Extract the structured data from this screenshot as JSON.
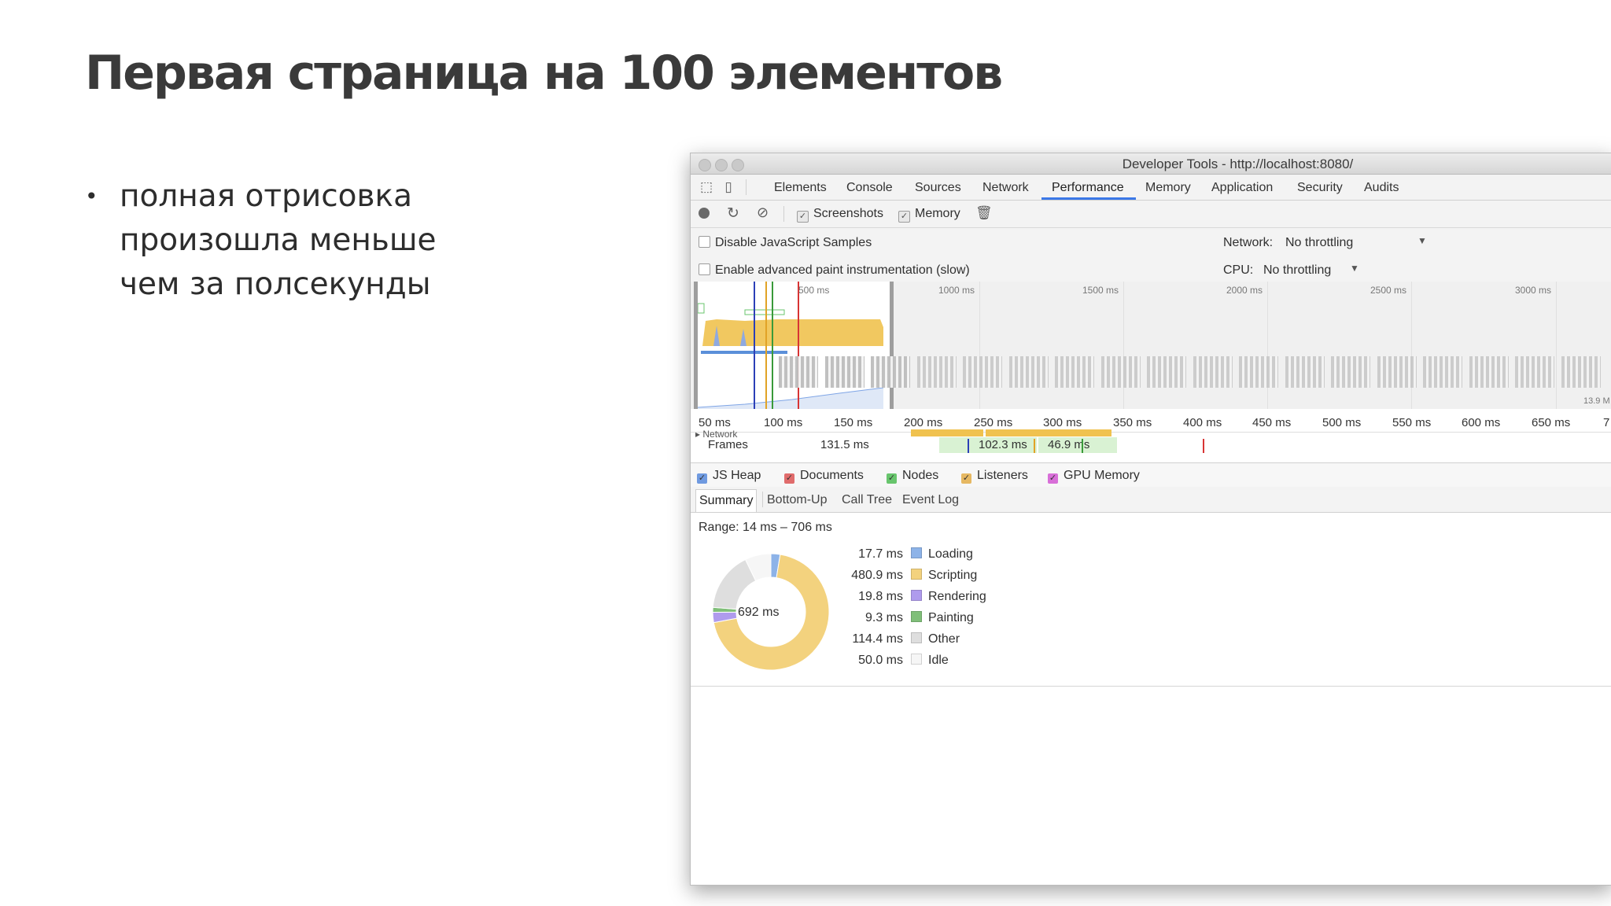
{
  "slide": {
    "title": "Первая страница на 100 элементов",
    "bullet": [
      "полная отрисовка",
      "произошла меньше",
      "чем за полсекунды"
    ]
  },
  "window": {
    "title": "Developer Tools - http://localhost:8080/"
  },
  "tabs": [
    "Elements",
    "Console",
    "Sources",
    "Network",
    "Performance",
    "Memory",
    "Application",
    "Security",
    "Audits"
  ],
  "active_tab": "Performance",
  "controls": {
    "screenshots": "Screenshots",
    "memory": "Memory"
  },
  "settings": {
    "disable_js": "Disable JavaScript Samples",
    "advanced_paint": "Enable advanced paint instrumentation (slow)",
    "network_label": "Network:",
    "network_value": "No throttling",
    "cpu_label": "CPU:",
    "cpu_value": "No throttling"
  },
  "overview": {
    "ticks": [
      "500 ms",
      "1000 ms",
      "1500 ms",
      "2000 ms",
      "2500 ms",
      "3000 ms"
    ],
    "mem_label": "13.9 M"
  },
  "ruler": [
    "50 ms",
    "100 ms",
    "150 ms",
    "200 ms",
    "250 ms",
    "300 ms",
    "350 ms",
    "400 ms",
    "450 ms",
    "500 ms",
    "550 ms",
    "600 ms",
    "650 ms",
    "7"
  ],
  "tracks": {
    "network": "Network",
    "frames": "Frames",
    "f1": "131.5 ms",
    "f2": "102.3 ms",
    "f3": "46.9 ms"
  },
  "legend": [
    {
      "label": "JS Heap",
      "color": "#6f9ae0"
    },
    {
      "label": "Documents",
      "color": "#e06c6c"
    },
    {
      "label": "Nodes",
      "color": "#68c56d"
    },
    {
      "label": "Listeners",
      "color": "#e6b862"
    },
    {
      "label": "GPU Memory",
      "color": "#d86fd8"
    }
  ],
  "subtabs": [
    "Summary",
    "Bottom-Up",
    "Call Tree",
    "Event Log"
  ],
  "summary": {
    "range": "Range: 14 ms – 706 ms",
    "total": "692 ms",
    "rows": [
      {
        "value": "17.7 ms",
        "label": "Loading",
        "color": "#8db3e8"
      },
      {
        "value": "480.9 ms",
        "label": "Scripting",
        "color": "#f3d27e"
      },
      {
        "value": "19.8 ms",
        "label": "Rendering",
        "color": "#af9bed"
      },
      {
        "value": "9.3 ms",
        "label": "Painting",
        "color": "#80bf79"
      },
      {
        "value": "114.4 ms",
        "label": "Other",
        "color": "#dedede"
      },
      {
        "value": "50.0 ms",
        "label": "Idle",
        "color": "#f6f6f6"
      }
    ]
  }
}
